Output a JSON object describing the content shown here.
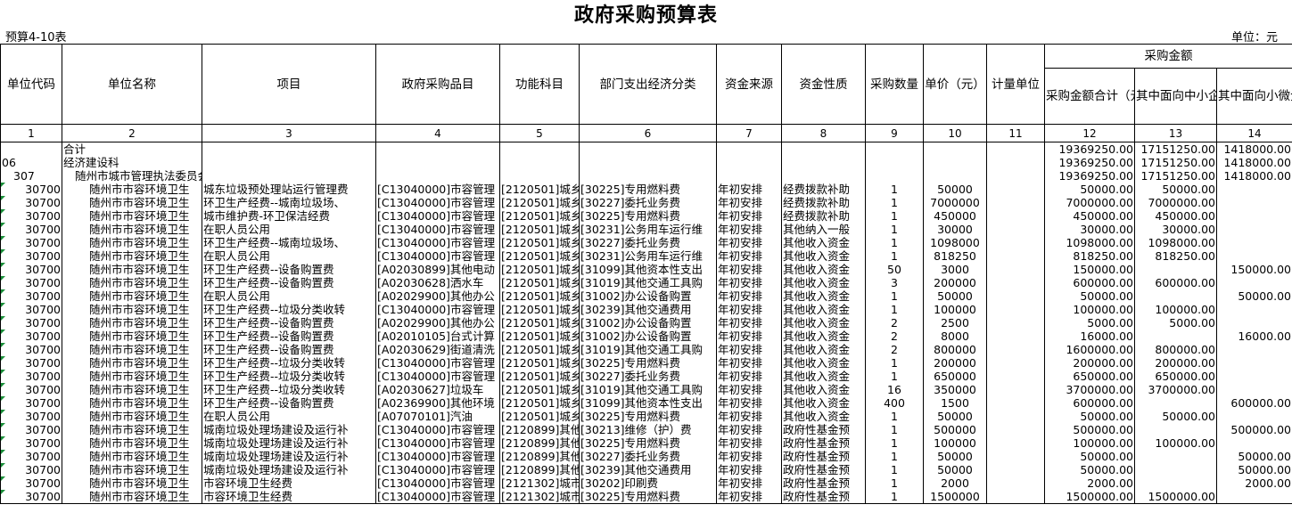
{
  "title": "政府采购预算表",
  "table_code": "预算4-10表",
  "unit_label": "单位：元",
  "headers": {
    "unit_code": "单位代码",
    "unit_name": "单位名称",
    "project": "项目",
    "purchase_item": "政府采购品目",
    "function_subject": "功能科目",
    "dept_expense_class": "部门支出经济分类",
    "fund_source": "资金来源",
    "fund_nature": "资金性质",
    "quantity": "采购数量",
    "unit_price": "单价（元）",
    "measure_unit": "计量单位",
    "purchase_amount_group": "采购金额",
    "amount_total": "采购金额合计（元）",
    "sme_amount": "其中面向中小企业（元）",
    "micro_amount": "其中面向小微企业（元）"
  },
  "column_numbers": [
    "1",
    "2",
    "3",
    "4",
    "5",
    "6",
    "7",
    "8",
    "9",
    "10",
    "11",
    "12",
    "13",
    "14"
  ],
  "rows": [
    [
      "",
      "合计",
      "",
      "",
      "",
      "",
      "",
      "",
      "",
      "",
      "",
      "19369250.00",
      "17151250.00",
      "1418000.00"
    ],
    [
      "06",
      "经济建设科",
      "",
      "",
      "",
      "",
      "",
      "",
      "",
      "",
      "",
      "19369250.00",
      "17151250.00",
      "1418000.00"
    ],
    [
      "307",
      "随州市城市管理执法委员会",
      "",
      "",
      "",
      "",
      "",
      "",
      "",
      "",
      "",
      "19369250.00",
      "17151250.00",
      "1418000.00"
    ],
    [
      "30700",
      "随州市市容环境卫生",
      "城东垃圾预处理站运行管理费",
      "[C13040000]市容管理",
      "[2120501]城乡",
      "[30225]专用燃料费",
      "年初安排",
      "经费拨款补助",
      "1",
      "50000",
      "",
      "50000.00",
      "50000.00",
      ""
    ],
    [
      "30700",
      "随州市市容环境卫生",
      "环卫生产经费--城南垃圾场、",
      "[C13040000]市容管理",
      "[2120501]城乡",
      "[30227]委托业务费",
      "年初安排",
      "经费拨款补助",
      "1",
      "7000000",
      "",
      "7000000.00",
      "7000000.00",
      ""
    ],
    [
      "30700",
      "随州市市容环境卫生",
      "城市维护费-环卫保洁经费",
      "[C13040000]市容管理",
      "[2120501]城乡",
      "[30225]专用燃料费",
      "年初安排",
      "经费拨款补助",
      "1",
      "450000",
      "",
      "450000.00",
      "450000.00",
      ""
    ],
    [
      "30700",
      "随州市市容环境卫生",
      "在职人员公用",
      "[C13040000]市容管理",
      "[2120501]城乡",
      "[30231]公务用车运行维",
      "年初安排",
      "其他纳入一般",
      "1",
      "30000",
      "",
      "30000.00",
      "30000.00",
      ""
    ],
    [
      "30700",
      "随州市市容环境卫生",
      "环卫生产经费--城南垃圾场、",
      "[C13040000]市容管理",
      "[2120501]城乡",
      "[30227]委托业务费",
      "年初安排",
      "其他收入资金",
      "1",
      "1098000",
      "",
      "1098000.00",
      "1098000.00",
      ""
    ],
    [
      "30700",
      "随州市市容环境卫生",
      "在职人员公用",
      "[C13040000]市容管理",
      "[2120501]城乡",
      "[30231]公务用车运行维",
      "年初安排",
      "其他收入资金",
      "1",
      "818250",
      "",
      "818250.00",
      "818250.00",
      ""
    ],
    [
      "30700",
      "随州市市容环境卫生",
      "环卫生产经费--设备购置费",
      "[A02030899]其他电动",
      "[2120501]城乡",
      "[31099]其他资本性支出",
      "年初安排",
      "其他收入资金",
      "50",
      "3000",
      "",
      "150000.00",
      "",
      "150000.00"
    ],
    [
      "30700",
      "随州市市容环境卫生",
      "环卫生产经费--设备购置费",
      "[A02030628]洒水车",
      "[2120501]城乡",
      "[31019]其他交通工具购",
      "年初安排",
      "其他收入资金",
      "3",
      "200000",
      "",
      "600000.00",
      "600000.00",
      ""
    ],
    [
      "30700",
      "随州市市容环境卫生",
      "在职人员公用",
      "[A02029900]其他办公",
      "[2120501]城乡",
      "[31002]办公设备购置",
      "年初安排",
      "其他收入资金",
      "1",
      "50000",
      "",
      "50000.00",
      "",
      "50000.00"
    ],
    [
      "30700",
      "随州市市容环境卫生",
      "环卫生产经费--垃圾分类收转",
      "[C13040000]市容管理",
      "[2120501]城乡",
      "[30239]其他交通费用",
      "年初安排",
      "其他收入资金",
      "1",
      "100000",
      "",
      "100000.00",
      "100000.00",
      ""
    ],
    [
      "30700",
      "随州市市容环境卫生",
      "环卫生产经费--设备购置费",
      "[A02029900]其他办公",
      "[2120501]城乡",
      "[31002]办公设备购置",
      "年初安排",
      "其他收入资金",
      "2",
      "2500",
      "",
      "5000.00",
      "5000.00",
      ""
    ],
    [
      "30700",
      "随州市市容环境卫生",
      "环卫生产经费--设备购置费",
      "[A02010105]台式计算",
      "[2120501]城乡",
      "[31002]办公设备购置",
      "年初安排",
      "其他收入资金",
      "2",
      "8000",
      "",
      "16000.00",
      "",
      "16000.00"
    ],
    [
      "30700",
      "随州市市容环境卫生",
      "环卫生产经费--设备购置费",
      "[A02030629]街道清洗",
      "[2120501]城乡",
      "[31019]其他交通工具购",
      "年初安排",
      "其他收入资金",
      "2",
      "800000",
      "",
      "1600000.00",
      "800000.00",
      ""
    ],
    [
      "30700",
      "随州市市容环境卫生",
      "环卫生产经费--垃圾分类收转",
      "[C13040000]市容管理",
      "[2120501]城乡",
      "[30225]专用燃料费",
      "年初安排",
      "其他收入资金",
      "1",
      "200000",
      "",
      "200000.00",
      "200000.00",
      ""
    ],
    [
      "30700",
      "随州市市容环境卫生",
      "环卫生产经费--垃圾分类收转",
      "[C13040000]市容管理",
      "[2120501]城乡",
      "[30227]委托业务费",
      "年初安排",
      "其他收入资金",
      "1",
      "650000",
      "",
      "650000.00",
      "650000.00",
      ""
    ],
    [
      "30700",
      "随州市市容环境卫生",
      "环卫生产经费--垃圾分类收转",
      "[A02030627]垃圾车",
      "[2120501]城乡",
      "[31019]其他交通工具购",
      "年初安排",
      "其他收入资金",
      "16",
      "350000",
      "",
      "3700000.00",
      "3700000.00",
      ""
    ],
    [
      "30700",
      "随州市市容环境卫生",
      "环卫生产经费--设备购置费",
      "[A02369900]其他环境",
      "[2120501]城乡",
      "[31099]其他资本性支出",
      "年初安排",
      "其他收入资金",
      "400",
      "1500",
      "",
      "600000.00",
      "",
      "600000.00"
    ],
    [
      "30700",
      "随州市市容环境卫生",
      "在职人员公用",
      "[A07070101]汽油",
      "[2120501]城乡",
      "[30225]专用燃料费",
      "年初安排",
      "其他收入资金",
      "1",
      "50000",
      "",
      "50000.00",
      "50000.00",
      ""
    ],
    [
      "30700",
      "随州市市容环境卫生",
      "城南垃圾处理场建设及运行补",
      "[C13040000]市容管理",
      "[2120899]其他",
      "[30213]维修（护）费",
      "年初安排",
      "政府性基金预",
      "1",
      "500000",
      "",
      "500000.00",
      "",
      "500000.00"
    ],
    [
      "30700",
      "随州市市容环境卫生",
      "城南垃圾处理场建设及运行补",
      "[C13040000]市容管理",
      "[2120899]其他",
      "[30225]专用燃料费",
      "年初安排",
      "政府性基金预",
      "1",
      "100000",
      "",
      "100000.00",
      "100000.00",
      ""
    ],
    [
      "30700",
      "随州市市容环境卫生",
      "城南垃圾处理场建设及运行补",
      "[C13040000]市容管理",
      "[2120899]其他",
      "[30227]委托业务费",
      "年初安排",
      "政府性基金预",
      "1",
      "50000",
      "",
      "50000.00",
      "",
      "50000.00"
    ],
    [
      "30700",
      "随州市市容环境卫生",
      "城南垃圾处理场建设及运行补",
      "[C13040000]市容管理",
      "[2120899]其他",
      "[30239]其他交通费用",
      "年初安排",
      "政府性基金预",
      "1",
      "50000",
      "",
      "50000.00",
      "",
      "50000.00"
    ],
    [
      "30700",
      "随州市市容环境卫生",
      "市容环境卫生经费",
      "[C13040000]市容管理",
      "[2121302]城市",
      "[30202]印刷费",
      "年初安排",
      "政府性基金预",
      "1",
      "2000",
      "",
      "2000.00",
      "",
      "2000.00"
    ],
    [
      "30700",
      "随州市市容环境卫生",
      "市容环境卫生经费",
      "[C13040000]市容管理",
      "[2121302]城市",
      "[30225]专用燃料费",
      "年初安排",
      "政府性基金预",
      "1",
      "1500000",
      "",
      "1500000.00",
      "1500000.00",
      ""
    ]
  ]
}
